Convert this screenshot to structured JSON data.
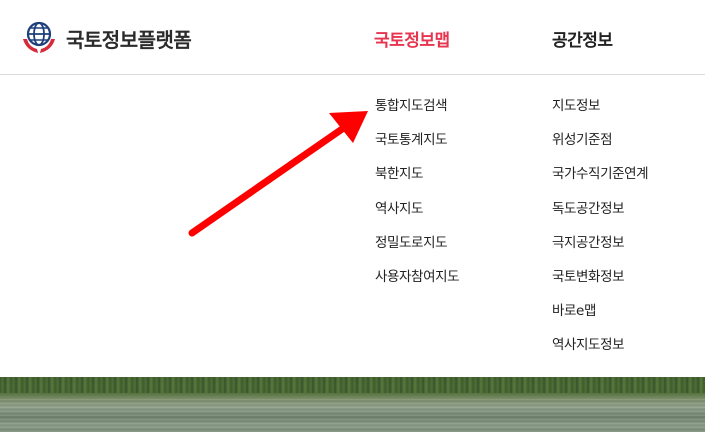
{
  "header": {
    "logo_text": "국토정보플랫폼",
    "logo_icon": "globe-hands-icon",
    "nav": [
      {
        "label": "국토정보맵",
        "active": true
      },
      {
        "label": "공간정보",
        "active": false
      }
    ]
  },
  "menu": {
    "column_1": [
      "통합지도검색",
      "국토통계지도",
      "북한지도",
      "역사지도",
      "정밀도로지도",
      "사용자참여지도"
    ],
    "column_2": [
      "지도정보",
      "위성기준점",
      "국가수직기준연계",
      "독도공간정보",
      "극지공간정보",
      "국토변화정보",
      "바로e맵",
      "역사지도정보"
    ]
  },
  "annotation": {
    "icon": "red-arrow-icon",
    "color": "#ff0000",
    "points_to": "통합지도검색"
  },
  "colors": {
    "active_nav": "#e8344e",
    "text": "#222222",
    "logo_blue": "#1d3f7a",
    "logo_red": "#d62b3a",
    "divider": "#dcdcdc"
  }
}
